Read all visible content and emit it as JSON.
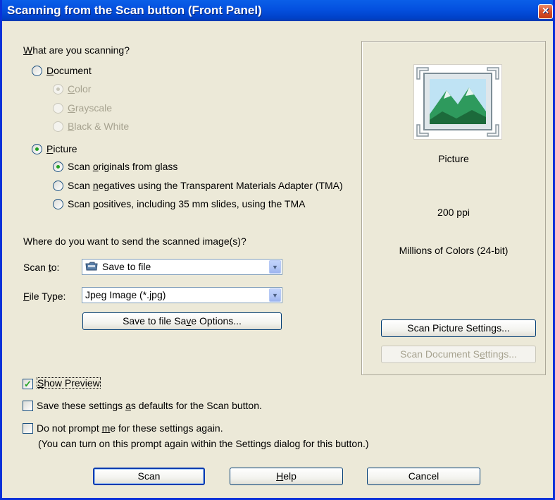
{
  "window": {
    "title": "Scanning from the Scan button (Front Panel)",
    "close_glyph": "×"
  },
  "scanning": {
    "question_pre": "",
    "question_key": "W",
    "question_post": "hat are you scanning?",
    "document": {
      "pre": "",
      "key": "D",
      "post": "ocument"
    },
    "color": {
      "pre": "",
      "key": "C",
      "post": "olor"
    },
    "grayscale": {
      "pre": "",
      "key": "G",
      "post": "rayscale"
    },
    "bw": {
      "pre": "",
      "key": "B",
      "post": "lack & White"
    },
    "picture": {
      "pre": "",
      "key": "P",
      "post": "icture"
    },
    "glass": {
      "pre": "Scan ",
      "key": "o",
      "post": "riginals from glass"
    },
    "negatives": {
      "pre": "Scan ",
      "key": "n",
      "post": "egatives using the Transparent Materials Adapter (TMA)"
    },
    "positives": {
      "pre": "Scan ",
      "key": "p",
      "post": "ositives, including 35 mm slides, using the TMA"
    }
  },
  "send": {
    "question": "Where do you want to send the scanned image(s)?",
    "scan_to_label": {
      "pre": "Scan ",
      "key": "t",
      "post": "o:"
    },
    "scan_to_value": "Save to file",
    "file_type_label": {
      "pre": "",
      "key": "F",
      "post": "ile Type:"
    },
    "file_type_value": "Jpeg Image (*.jpg)",
    "save_options": {
      "pre": "Save to file Sa",
      "key": "v",
      "post": "e Options..."
    }
  },
  "preview_panel": {
    "type_label": "Picture",
    "resolution": "200 ppi",
    "color_depth": "Millions of Colors (24-bit)",
    "picture_settings": "Scan Picture Settings...",
    "document_settings": {
      "pre": "Scan Document S",
      "key": "e",
      "post": "ttings..."
    }
  },
  "options": {
    "show_preview": {
      "pre": "",
      "key": "S",
      "post": "how Preview"
    },
    "save_defaults": {
      "pre": "Save these settings ",
      "key": "a",
      "post": "s defaults for the Scan button."
    },
    "no_prompt": {
      "pre": "Do not prompt ",
      "key": "m",
      "post": "e for these settings again."
    },
    "no_prompt_note": "(You can turn on this prompt again within the Settings dialog for this button.)"
  },
  "buttons": {
    "scan": "Scan",
    "help": {
      "pre": "",
      "key": "H",
      "post": "elp"
    },
    "cancel": "Cancel"
  },
  "icons": {
    "scan_to": "folder-scanner-icon",
    "thumbnail": "landscape-picture-icon"
  },
  "colors": {
    "title_bar": "#0450df",
    "dialog_bg": "#ece9d8",
    "check_green": "#21a121",
    "close_red": "#d84f2a"
  }
}
